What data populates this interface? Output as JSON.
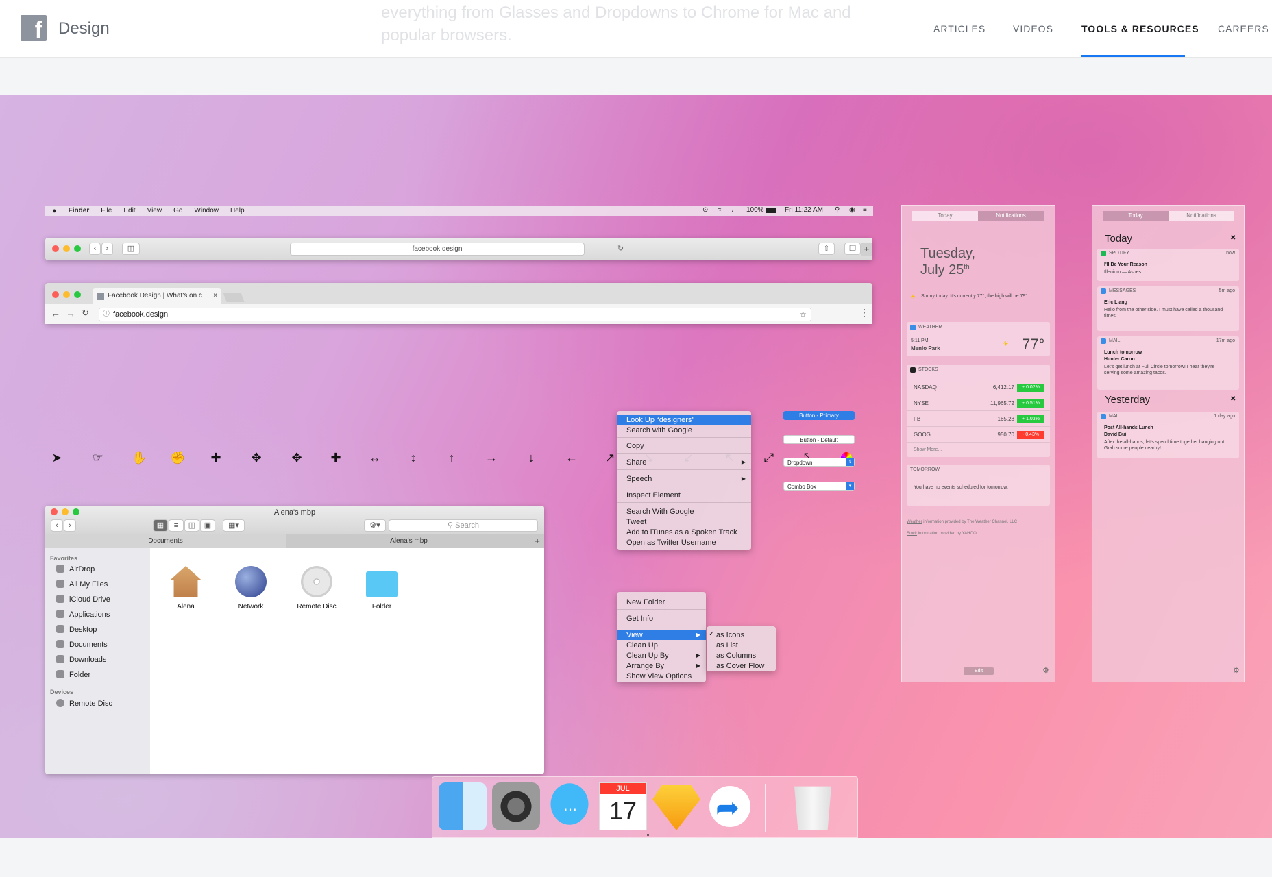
{
  "header": {
    "brand": "Design",
    "nav": [
      "ARTICLES",
      "VIDEOS",
      "TOOLS & RESOURCES",
      "CAREERS"
    ],
    "active_nav": "TOOLS & RESOURCES",
    "behind_text": "everything from Glasses and Dropdowns to Chrome for Mac and popular browsers."
  },
  "menubar": {
    "items": [
      "Finder",
      "File",
      "Edit",
      "View",
      "Go",
      "Window",
      "Help"
    ],
    "battery": "100%",
    "clock": "Fri 11:22 AM"
  },
  "safari": {
    "url": "facebook.design"
  },
  "chrome": {
    "tab_title": "Facebook Design | What's on c",
    "url": "facebook.design"
  },
  "finder": {
    "title": "Alena's mbp",
    "search_placeholder": "Search",
    "tabs": [
      "Documents",
      "Alena's mbp"
    ],
    "favorites_label": "Favorites",
    "favorites": [
      "AirDrop",
      "All My Files",
      "iCloud Drive",
      "Applications",
      "Desktop",
      "Documents",
      "Downloads",
      "Folder"
    ],
    "devices_label": "Devices",
    "devices": [
      "Remote Disc"
    ],
    "items": [
      "Alena",
      "Network",
      "Remote Disc",
      "Folder"
    ]
  },
  "context_menu": {
    "items": [
      "Look Up “designers”",
      "Search with Google",
      "Copy",
      "Share",
      "Speech",
      "Inspect Element",
      "Search With Google",
      "Tweet",
      "Add to iTunes as a Spoken Track",
      "Open as Twitter Username"
    ]
  },
  "folder_menu": {
    "items": [
      "New Folder",
      "Get Info",
      "View",
      "Clean Up",
      "Clean Up By",
      "Arrange By",
      "Show View Options"
    ],
    "submenu": [
      "as Icons",
      "as List",
      "as Columns",
      "as Cover Flow"
    ]
  },
  "controls": {
    "primary": "Button - Primary",
    "default": "Button - Default",
    "dropdown": "Dropdown",
    "combo": "Combo Box"
  },
  "today_panel": {
    "segments": [
      "Today",
      "Notifications"
    ],
    "date_line1": "Tuesday,",
    "date_line2": "July 25",
    "date_sup": "th",
    "summary": "Sunny today. It's currently 77°; the high will be 79°.",
    "weather_label": "WEATHER",
    "weather_time": "5:11 PM",
    "weather_place": "Menlo Park",
    "weather_temp": "77°",
    "stocks_label": "STOCKS",
    "stocks": [
      {
        "name": "NASDAQ",
        "price": "6,412.17",
        "change": "+ 0.02%",
        "up": true
      },
      {
        "name": "NYSE",
        "price": "11,965.72",
        "change": "+ 0.51%",
        "up": true
      },
      {
        "name": "FB",
        "price": "165.28",
        "change": "+ 1.03%",
        "up": true
      },
      {
        "name": "GOOG",
        "price": "950.70",
        "change": "- 0.43%",
        "up": false
      }
    ],
    "show_more": "Show More...",
    "tomorrow_label": "TOMORROW",
    "tomorrow_text": "You have no events scheduled for tomorrow.",
    "credit1_link": "Weather",
    "credit1_text": " information provided by The Weather Channel, LLC",
    "credit2_link": "Stock",
    "credit2_text": " information provided by YAHOO!",
    "edit": "Edit"
  },
  "notif_panel": {
    "segments": [
      "Today",
      "Notifications"
    ],
    "today": "Today",
    "yesterday": "Yesterday",
    "cards": [
      {
        "app": "SPOTIFY",
        "time": "now",
        "title": "I'll Be Your Reason",
        "body": "Illenium — Ashes"
      },
      {
        "app": "MESSAGES",
        "time": "5m ago",
        "title": "Eric Liang",
        "body": "Hello from the other side. I must have called a thousand times."
      },
      {
        "app": "MAIL",
        "time": "17m ago",
        "title": "Lunch tomorrow",
        "sub": "Hunter Caron",
        "body": "Let's get lunch at Full Circle tomorrow! I hear they're serving some amazing tacos."
      },
      {
        "app": "MAIL",
        "time": "1 day ago",
        "title": "Post All-hands Lunch",
        "sub": "David Bui",
        "body": "After the all-hands, let's spend time together hanging out. Grab some people nearby!"
      }
    ]
  },
  "dock": {
    "apps": [
      "finder-icon",
      "system-preferences-icon",
      "messages-icon",
      "calendar-icon",
      "sketch-icon",
      "linear-app-icon",
      "trash-icon"
    ],
    "calendar_month": "JUL",
    "calendar_day": "17"
  },
  "colors": {
    "accent": "#1877f2",
    "highlight": "#2f7ee6",
    "up": "#27c93f",
    "down": "#ff3b30"
  }
}
